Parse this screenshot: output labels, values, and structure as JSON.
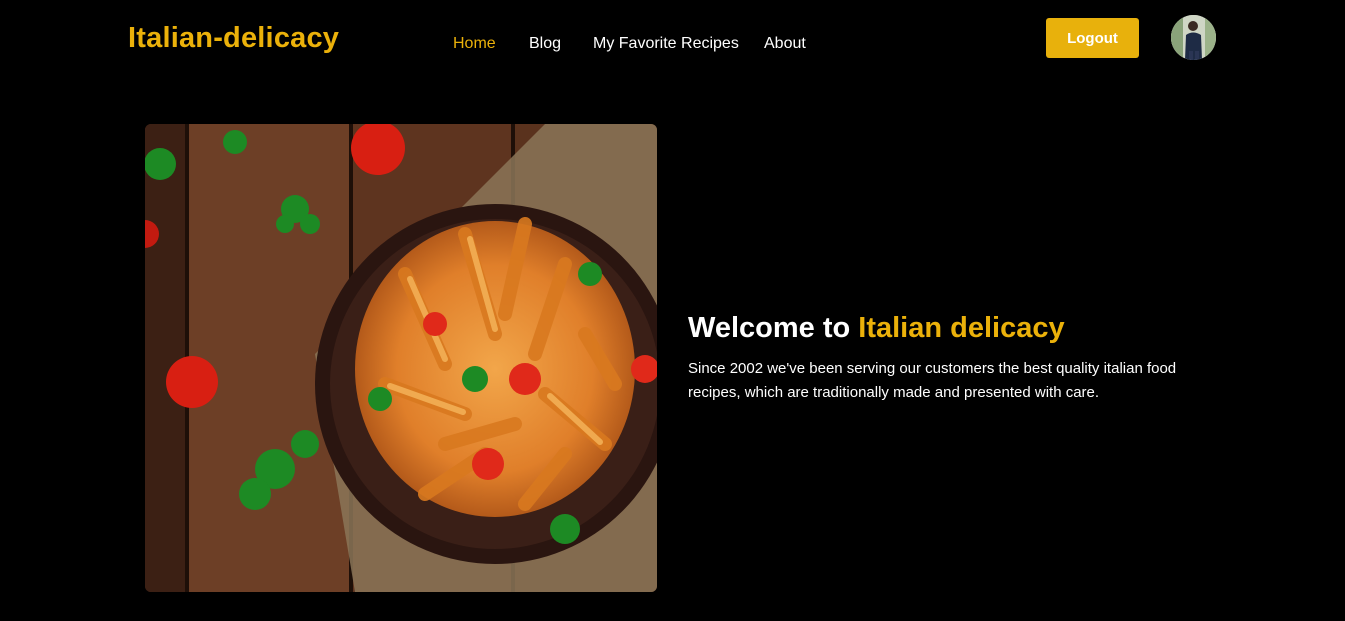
{
  "header": {
    "logo": "Italian-delicacy",
    "nav": [
      {
        "label": "Home",
        "active": true
      },
      {
        "label": "Blog",
        "active": false
      },
      {
        "label": "My Favorite Recipes",
        "active": false
      },
      {
        "label": "About",
        "active": false
      }
    ],
    "logout_label": "Logout"
  },
  "hero": {
    "title_prefix": "Welcome to ",
    "title_accent": "Italian delicacy",
    "description": "Since 2002 we've been serving our customers the best quality italian food recipes, which are traditionally made and presented with care."
  },
  "colors": {
    "background": "#000000",
    "accent": "#ebb10a",
    "button": "#e8b10c",
    "text": "#ffffff"
  },
  "icons": {
    "avatar": "user-avatar",
    "hero_image": "pasta-dish-photo"
  }
}
